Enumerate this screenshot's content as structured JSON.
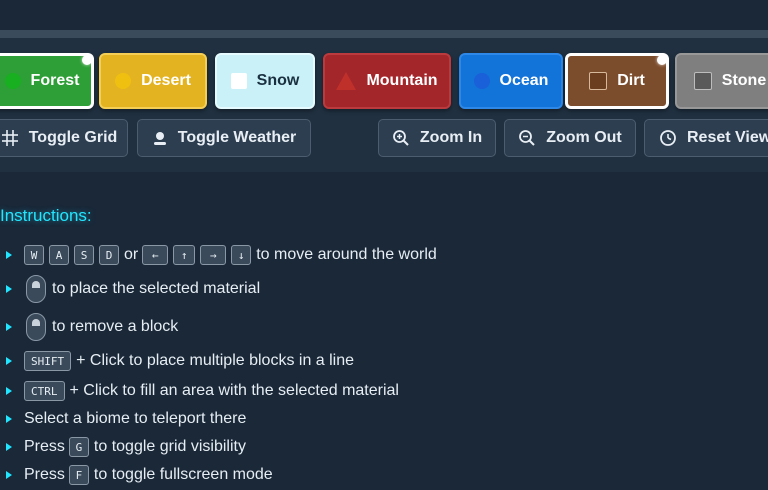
{
  "materials": [
    {
      "label": "Forest",
      "bg": "#2e9e37",
      "swatch": "#18b020",
      "shape": "circle",
      "selected": true
    },
    {
      "label": "Desert",
      "bg": "#e3b321",
      "swatch": "#f0c010",
      "shape": "circle",
      "selected": false
    },
    {
      "label": "Snow",
      "bg": "#c9f1f7",
      "swatch": "#ffffff",
      "shape": "square",
      "selected": false
    },
    {
      "label": "Mountain",
      "bg": "#a3262b",
      "swatch": "#c0302a",
      "shape": "triangle",
      "selected": false
    },
    {
      "label": "Ocean",
      "bg": "#1273d9",
      "swatch": "#1a60d8",
      "shape": "circle",
      "selected": false
    },
    {
      "label": "Dirt",
      "bg": "#7c4d2d",
      "swatch": "#6b3e20",
      "shape": "square",
      "selected": true
    },
    {
      "label": "Stone",
      "bg": "#7f7f7f",
      "swatch": "#5a5a5a",
      "shape": "square",
      "selected": false
    }
  ],
  "controls": {
    "toggle_grid": "Toggle Grid",
    "toggle_weather": "Toggle Weather",
    "zoom_in": "Zoom In",
    "zoom_out": "Zoom Out",
    "reset_view": "Reset View"
  },
  "instructions": {
    "title": "Instructions:",
    "keys_wasd": [
      "W",
      "A",
      "S",
      "D"
    ],
    "or": "or",
    "keys_arrows": [
      "←",
      "↑",
      "→",
      "↓"
    ],
    "move_text": "to move around the world",
    "place_text": "to place the selected material",
    "remove_text": "to remove a block",
    "shift_key": "SHIFT",
    "shift_text": "+ Click to place multiple blocks in a line",
    "ctrl_key": "CTRL",
    "ctrl_text": "+ Click to fill an area with the selected material",
    "biome_text": "Select a biome to teleport there",
    "press": "Press",
    "g_key": "G",
    "grid_text": "to toggle grid visibility",
    "f_key": "F",
    "fullscreen_text": "to toggle fullscreen mode"
  }
}
